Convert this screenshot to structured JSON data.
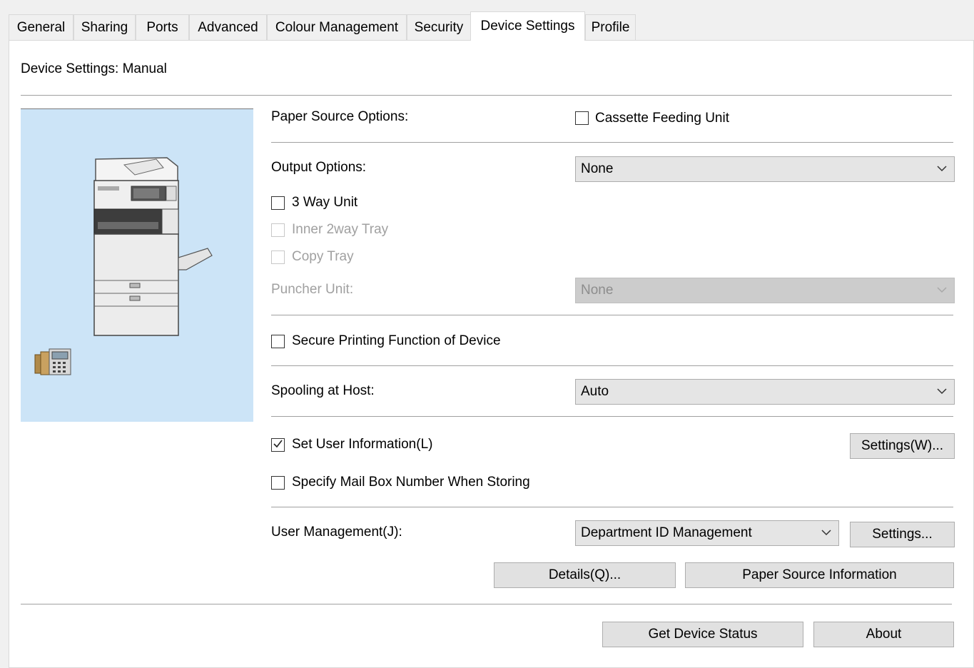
{
  "tabs": [
    {
      "label": "General"
    },
    {
      "label": "Sharing"
    },
    {
      "label": "Ports"
    },
    {
      "label": "Advanced"
    },
    {
      "label": "Colour Management"
    },
    {
      "label": "Security"
    },
    {
      "label": "Device Settings"
    },
    {
      "label": "Profile"
    }
  ],
  "active_tab": "Device Settings",
  "header": {
    "title": "Device Settings: Manual"
  },
  "paper_source": {
    "label": "Paper Source Options:",
    "cassette_label": "Cassette Feeding Unit",
    "cassette_checked": false
  },
  "output": {
    "label": "Output Options:",
    "value": "None",
    "three_way_label": "3 Way Unit",
    "three_way_checked": false,
    "inner_tray_label": "Inner 2way Tray",
    "inner_tray_checked": false,
    "copy_tray_label": "Copy Tray",
    "copy_tray_checked": false,
    "puncher_label": "Puncher Unit:",
    "puncher_value": "None"
  },
  "secure": {
    "label": "Secure Printing Function of Device",
    "checked": false
  },
  "spooling": {
    "label": "Spooling at Host:",
    "value": "Auto"
  },
  "user_info": {
    "label": "Set User Information(L)",
    "checked": true,
    "settings_label": "Settings(W)..."
  },
  "mailbox": {
    "label": "Specify Mail Box Number When Storing",
    "checked": false
  },
  "user_mgmt": {
    "label": "User Management(J):",
    "value": "Department ID Management",
    "settings_label": "Settings..."
  },
  "buttons": {
    "details": "Details(Q)...",
    "paper_source_info": "Paper Source Information",
    "get_status": "Get Device Status",
    "about": "About"
  },
  "icons": {
    "printer": "printer-illustration-icon",
    "office": "office-devices-icon",
    "chevron": "chevron-down-icon",
    "check": "checkmark-icon"
  }
}
